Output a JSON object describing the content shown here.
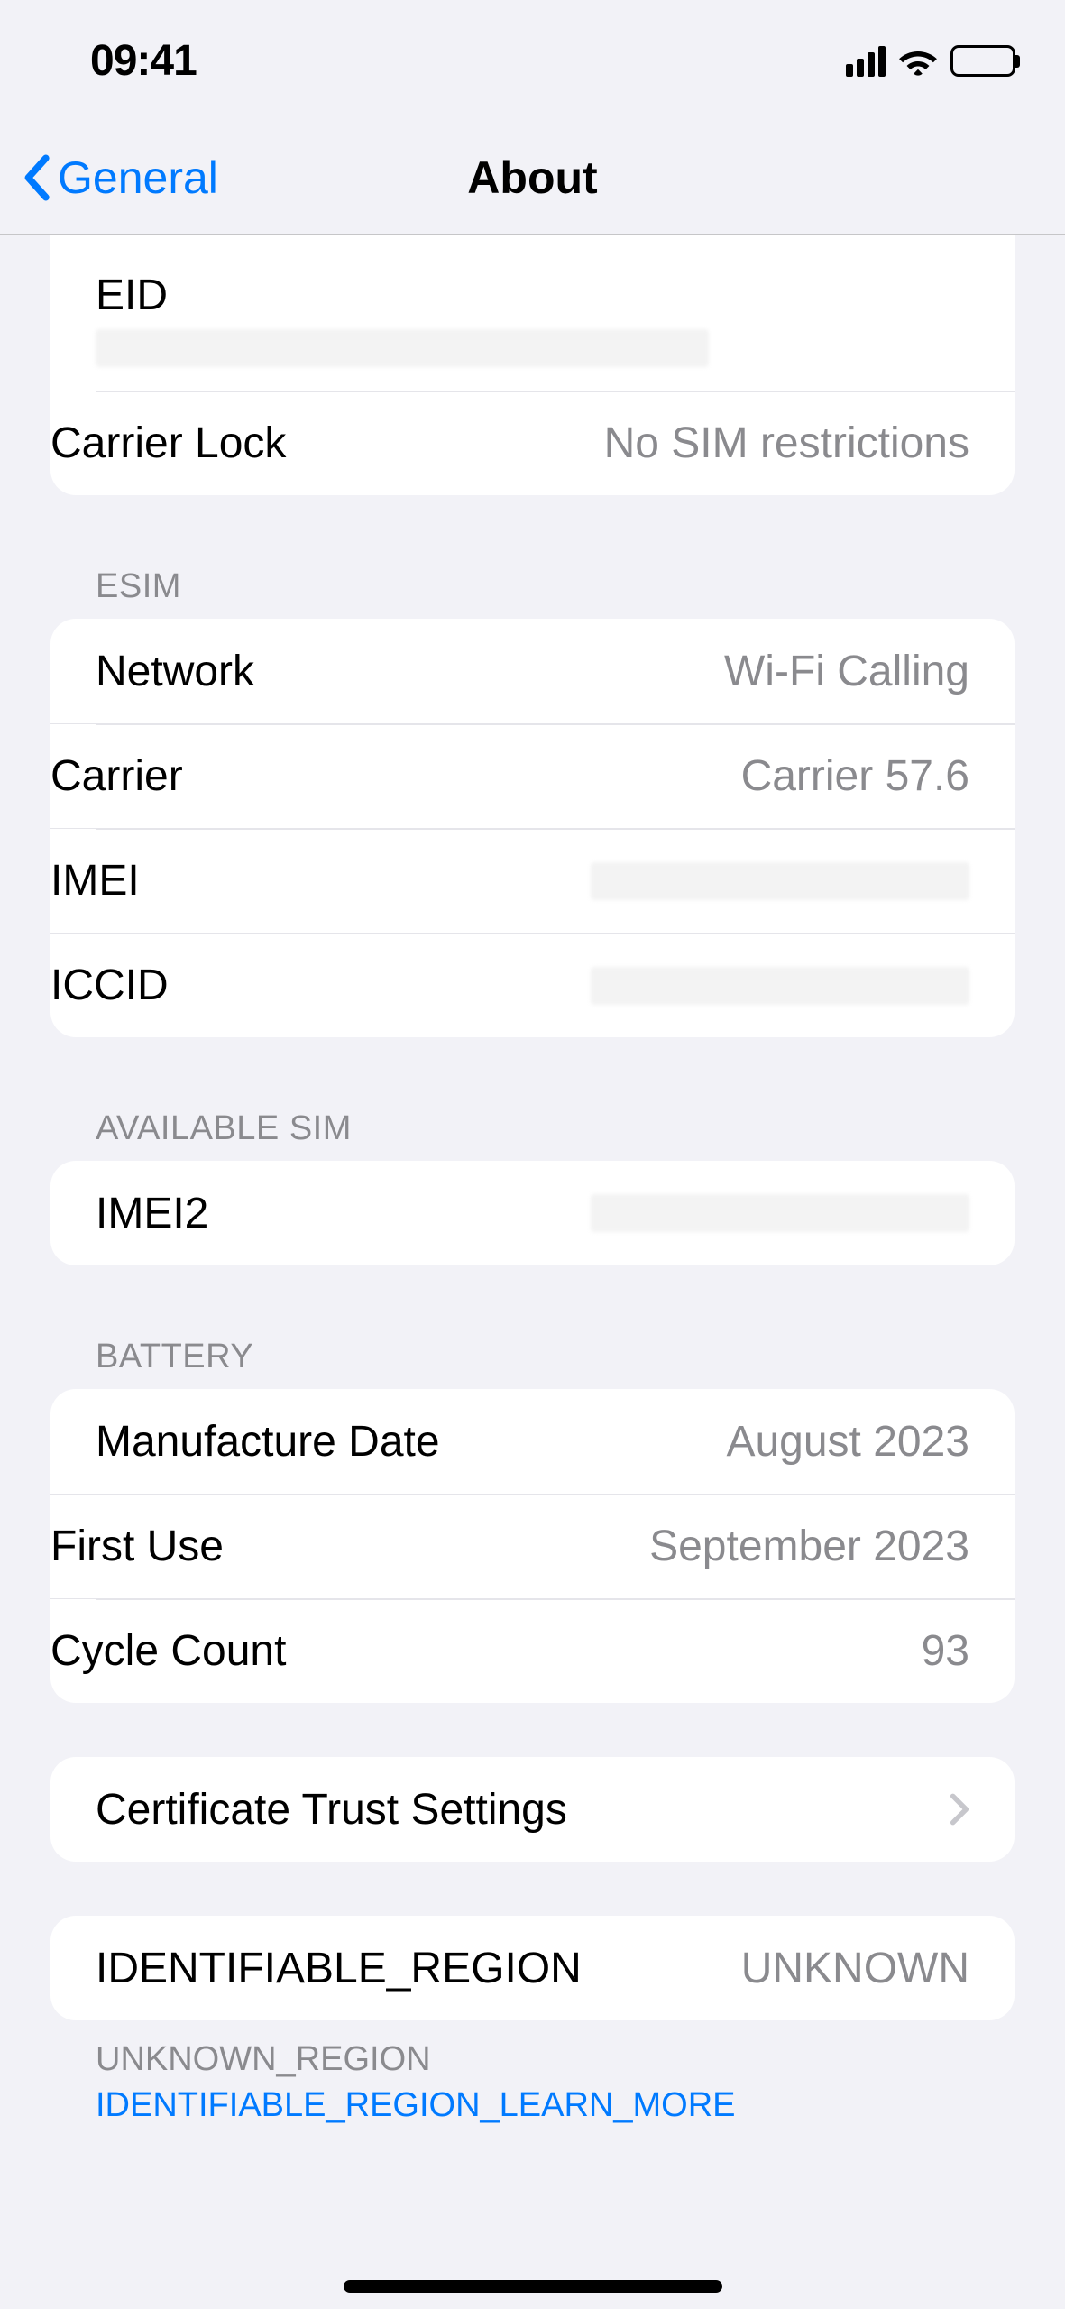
{
  "status_bar": {
    "time": "09:41"
  },
  "nav": {
    "back_label": "General",
    "title": "About"
  },
  "group_top": {
    "eid_label": "EID",
    "carrier_lock_label": "Carrier Lock",
    "carrier_lock_value": "No SIM restrictions"
  },
  "esim": {
    "header": "ESIM",
    "network_label": "Network",
    "network_value": "Wi-Fi Calling",
    "carrier_label": "Carrier",
    "carrier_value": "Carrier 57.6",
    "imei_label": "IMEI",
    "iccid_label": "ICCID"
  },
  "available_sim": {
    "header": "AVAILABLE SIM",
    "imei2_label": "IMEI2"
  },
  "battery": {
    "header": "BATTERY",
    "manufacture_date_label": "Manufacture Date",
    "manufacture_date_value": "August 2023",
    "first_use_label": "First Use",
    "first_use_value": "September 2023",
    "cycle_count_label": "Cycle Count",
    "cycle_count_value": "93"
  },
  "cert": {
    "label": "Certificate Trust Settings"
  },
  "region": {
    "label": "IDENTIFIABLE_REGION",
    "value": "UNKNOWN",
    "footer_prefix": "UNKNOWN_REGION ",
    "footer_link": "IDENTIFIABLE_REGION_LEARN_MORE"
  }
}
